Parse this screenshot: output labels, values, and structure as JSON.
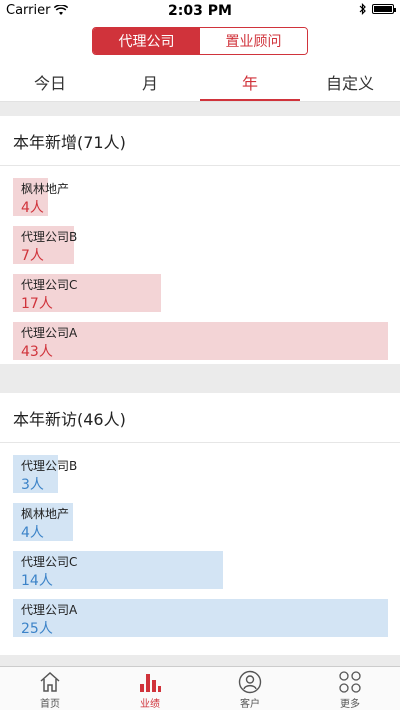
{
  "status_bar": {
    "carrier": "Carrier",
    "time": "2:03 PM"
  },
  "segmented": {
    "items": [
      "代理公司",
      "置业顾问"
    ],
    "active_index": 0
  },
  "tabs": {
    "items": [
      "今日",
      "月",
      "年",
      "自定义"
    ],
    "active_index": 2
  },
  "colors": {
    "accent": "#d0333b",
    "new_bar": "#f3d4d6",
    "visit_bar": "#d3e4f4",
    "visit_text": "#3c83c8"
  },
  "new_section": {
    "title": "本年新增(71人)",
    "max": 43,
    "items": [
      {
        "name": "枫林地产",
        "value_text": "4人",
        "value": 4
      },
      {
        "name": "代理公司B",
        "value_text": "7人",
        "value": 7
      },
      {
        "name": "代理公司C",
        "value_text": "17人",
        "value": 17
      },
      {
        "name": "代理公司A",
        "value_text": "43人",
        "value": 43
      }
    ]
  },
  "visit_section": {
    "title": "本年新访(46人)",
    "max": 25,
    "items": [
      {
        "name": "代理公司B",
        "value_text": "3人",
        "value": 3
      },
      {
        "name": "枫林地产",
        "value_text": "4人",
        "value": 4
      },
      {
        "name": "代理公司C",
        "value_text": "14人",
        "value": 14
      },
      {
        "name": "代理公司A",
        "value_text": "25人",
        "value": 25
      }
    ]
  },
  "tabbar": {
    "items": [
      {
        "label": "首页",
        "icon": "home-icon"
      },
      {
        "label": "业绩",
        "icon": "bar-chart-icon"
      },
      {
        "label": "客户",
        "icon": "user-icon"
      },
      {
        "label": "更多",
        "icon": "more-icon"
      }
    ],
    "active_index": 1
  }
}
